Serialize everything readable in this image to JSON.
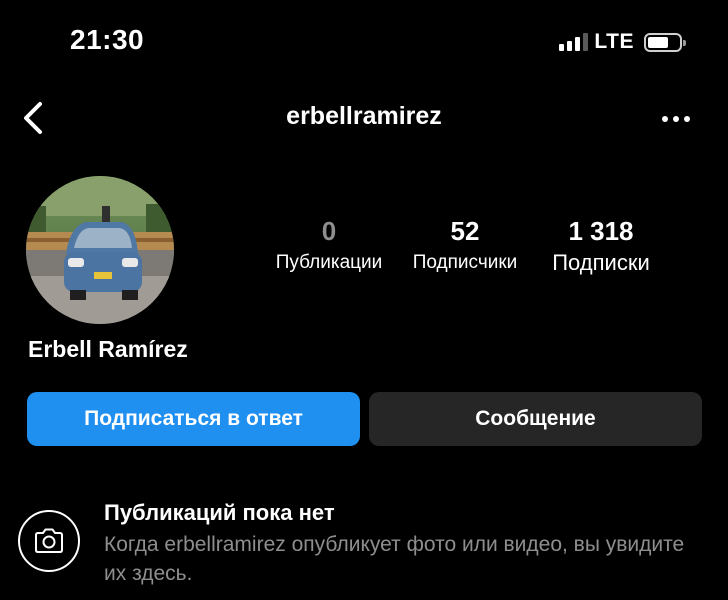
{
  "status_bar": {
    "time": "21:30",
    "network": "LTE",
    "signal_bars_active": 3,
    "signal_bars_total": 4,
    "battery_level": 0.6
  },
  "header": {
    "back_icon": "chevron-left-icon",
    "username": "erbellramirez",
    "more_icon": "more-horizontal-icon"
  },
  "profile": {
    "display_name": "Erbell Ramírez",
    "stats": {
      "posts": {
        "value": "0",
        "label": "Публикации"
      },
      "followers": {
        "value": "52",
        "label": "Подписчики"
      },
      "following": {
        "value": "1 318",
        "label": "Подписки"
      }
    }
  },
  "actions": {
    "follow_back_label": "Подписаться в ответ",
    "message_label": "Сообщение"
  },
  "empty_state": {
    "icon": "camera-icon",
    "title": "Публикаций пока нет",
    "description": "Когда erbellramirez опубликует фото или видео, вы увидите их здесь."
  },
  "colors": {
    "background": "#000000",
    "primary_button": "#1f8ff0",
    "secondary_button": "#262626",
    "muted_text": "#8e8e8e"
  }
}
